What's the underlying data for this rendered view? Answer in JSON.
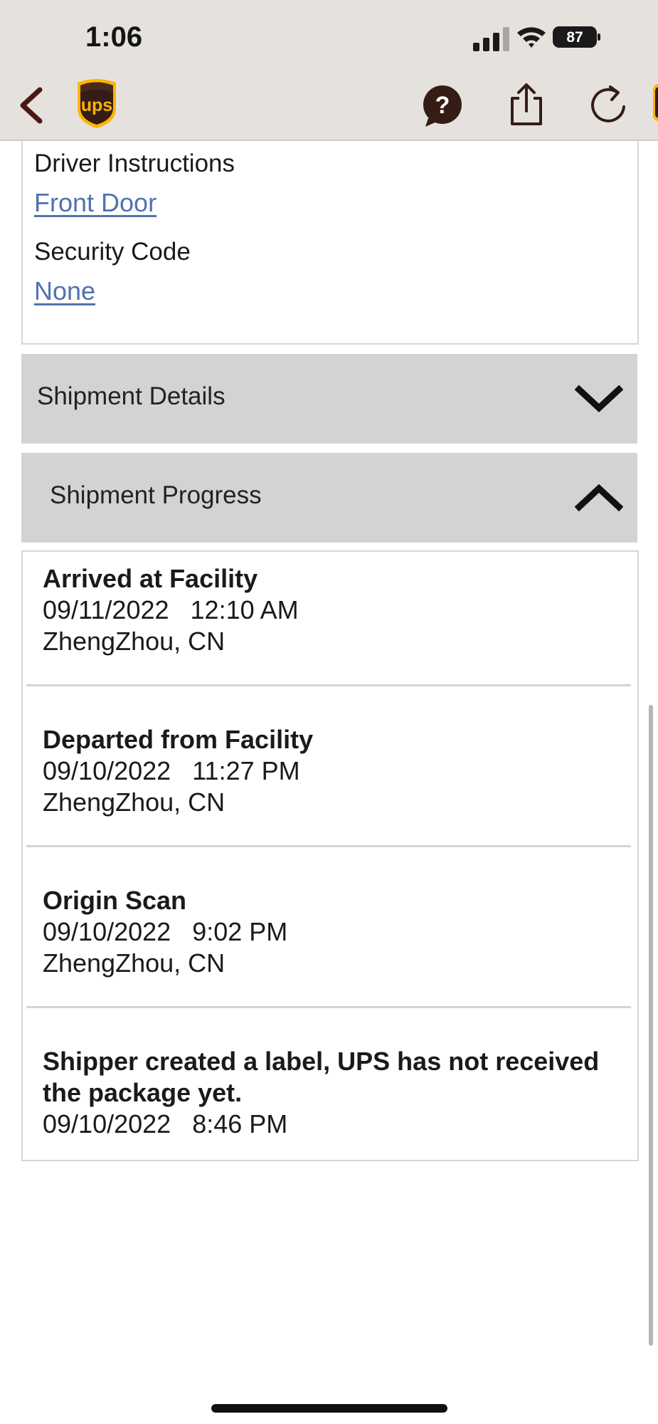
{
  "status_bar": {
    "time": "1:06",
    "battery": "87"
  },
  "nav": {
    "back_icon": "chevron-left-icon",
    "logo_text": "ups",
    "help_icon": "help-bubble-icon",
    "share_icon": "share-icon",
    "refresh_icon": "refresh-icon",
    "brand_color": "#351c15",
    "gold_color": "#ffb500"
  },
  "delivery_info": {
    "driver_instructions_label": "Driver Instructions",
    "driver_instructions_value": "Front Door",
    "security_code_label": "Security Code",
    "security_code_value": "None",
    "link_color": "#4f72b0"
  },
  "sections": {
    "shipment_details": {
      "label": "Shipment Details",
      "state": "collapsed"
    },
    "shipment_progress": {
      "label": "Shipment Progress",
      "state": "expanded"
    }
  },
  "progress": {
    "events": [
      {
        "status": "Arrived at Facility",
        "date": "09/11/2022",
        "time": "12:10 AM",
        "location": "ZhengZhou, CN"
      },
      {
        "status": "Departed from Facility",
        "date": "09/10/2022",
        "time": "11:27 PM",
        "location": "ZhengZhou, CN"
      },
      {
        "status": "Origin Scan",
        "date": "09/10/2022",
        "time": "9:02 PM",
        "location": "ZhengZhou, CN"
      },
      {
        "status_line1": "Shipper created a label, UPS has not received",
        "status_line2": "the package yet.",
        "date": "09/10/2022",
        "time": "8:46 PM"
      }
    ]
  }
}
